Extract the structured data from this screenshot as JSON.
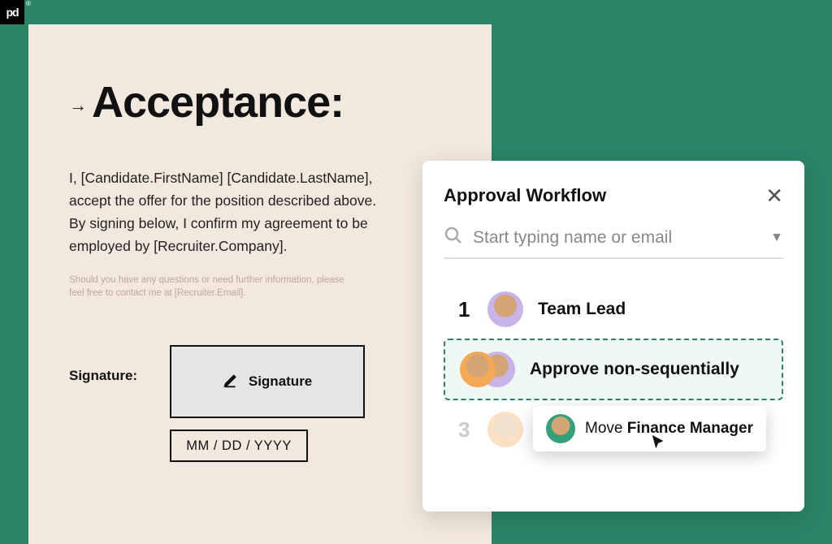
{
  "badge": "pd",
  "document": {
    "title": "Acceptance:",
    "body": "I, [Candidate.FirstName] [Candidate.LastName], accept the offer for the position described above. By signing below, I confirm my agreement to be employed by [Recruiter.Company].",
    "finePrint": "Should you have any questions or need further information, please feel free to contact me at [Recruiter.Email].",
    "signatureLabel": "Signature:",
    "signatureField": "Signature",
    "dateField": "MM / DD / YYYY"
  },
  "workflow": {
    "title": "Approval Workflow",
    "searchPlaceholder": "Start typing name or email",
    "items": [
      {
        "num": "1",
        "role": "Team Lead"
      },
      {
        "role": "Approve non-sequentially"
      },
      {
        "num": "3",
        "role": "Finance Manager"
      }
    ]
  },
  "tooltip": {
    "prefix": "Move ",
    "bold": "Finance Manager"
  }
}
